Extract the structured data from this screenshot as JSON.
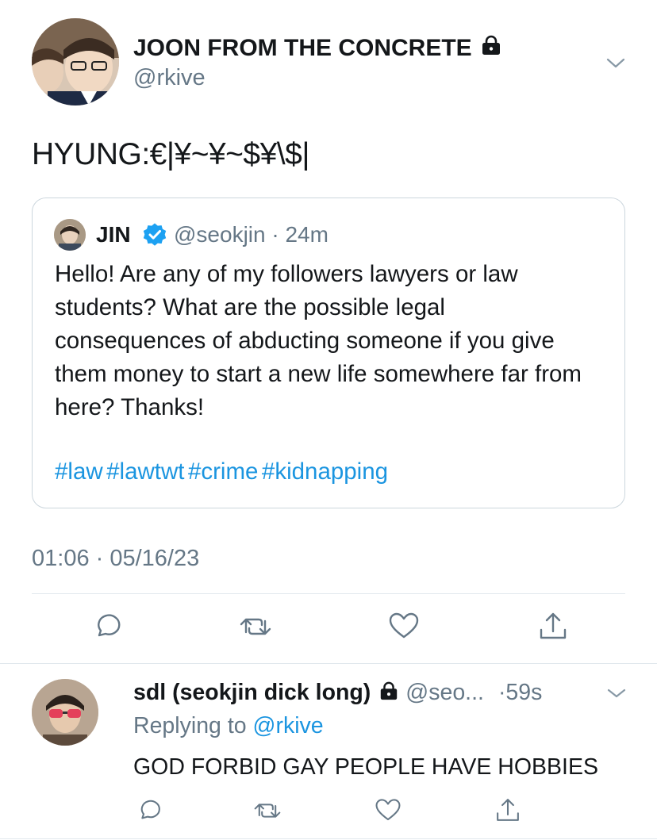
{
  "main_tweet": {
    "display_name": "JOON FROM THE CONCRETE",
    "handle": "@rkive",
    "text": "HYUNG:€|¥~¥~$¥\\$|",
    "timestamp": "01:06 · 05/16/23",
    "icons": {
      "protected": "lock-icon",
      "more": "chevron-down-icon"
    }
  },
  "quoted_tweet": {
    "display_name": "JIN",
    "handle": "@seokjin",
    "time": "24m",
    "verified": true,
    "text": "Hello! Are any of my followers lawyers or law students? What are the possible legal consequences of abducting someone if you give them money to start a new life somewhere far from here? Thanks!",
    "hashtags": [
      "#law",
      "#lawtwt",
      "#crime",
      "#kidnapping"
    ]
  },
  "actions": {
    "reply": "reply-icon",
    "retweet": "retweet-icon",
    "like": "like-icon",
    "share": "share-icon"
  },
  "reply_tweet": {
    "display_name": "sdl (seokjin dick long)",
    "handle": "@seo...",
    "time": "·59s",
    "replying_to_prefix": "Replying to",
    "replying_to_handle": "@rkive",
    "text": "GOD FORBID GAY PEOPLE HAVE HOBBIES"
  },
  "colors": {
    "link": "#1b95e0",
    "secondary_text": "#657786",
    "border": "#e1e8ed",
    "verified": "#1da1f2"
  }
}
